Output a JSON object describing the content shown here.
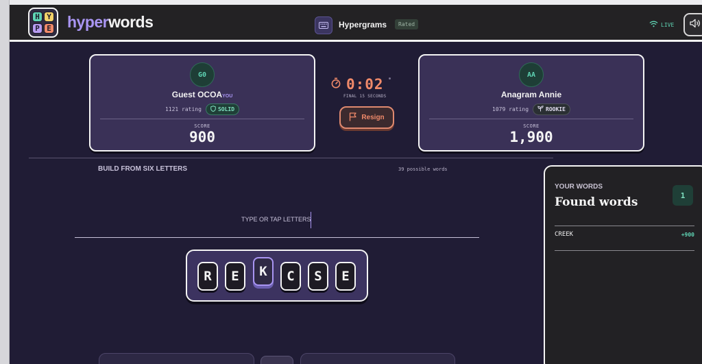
{
  "header": {
    "logo_letters": [
      "H",
      "Y",
      "P",
      "E"
    ],
    "logo_colors": [
      "#5fd4b4",
      "#f5d36a",
      "#b79cf2",
      "#f08a6a"
    ],
    "brand_part1": "hyper",
    "brand_part2": "words",
    "game_icon": "keyboard-icon",
    "game_name": "Hypergrams",
    "game_badge": "Rated",
    "status": "LIVE",
    "status_icon": "wifi-icon",
    "sound_icon": "speaker-icon"
  },
  "players": {
    "left": {
      "initials": "G0",
      "name": "Guest OCOA",
      "you_tag": "YOU",
      "rating": "1121 rating",
      "tier": "SOLID",
      "tier_icon": "shield-icon",
      "score_label": "SCORE",
      "score": "900"
    },
    "right": {
      "initials": "AA",
      "name": "Anagram Annie",
      "rating": "1079 rating",
      "tier": "ROOKIE",
      "tier_icon": "sprout-icon",
      "score_label": "SCORE",
      "score": "1,900"
    }
  },
  "timer": {
    "icon": "stopwatch-icon",
    "value": "0:02",
    "subtitle": "FINAL 15 SECONDS"
  },
  "resign": {
    "label": "Resign",
    "icon": "flag-icon"
  },
  "board": {
    "heading": "BUILD FROM SIX LETTERS",
    "possible": "39 possible words",
    "input_placeholder": "TYPE OR TAP LETTERS",
    "tiles": [
      "R",
      "E",
      "K",
      "C",
      "S",
      "E"
    ],
    "selected_tile_index": 2
  },
  "found_panel": {
    "kicker": "YOUR WORDS",
    "title": "Found words",
    "count": "1",
    "words": [
      {
        "word": "CREEK",
        "points": "+900"
      }
    ]
  },
  "colors": {
    "accent": "#a995f2",
    "success": "#5fd4b4",
    "danger": "#f08a6a",
    "background": "#201c35"
  }
}
